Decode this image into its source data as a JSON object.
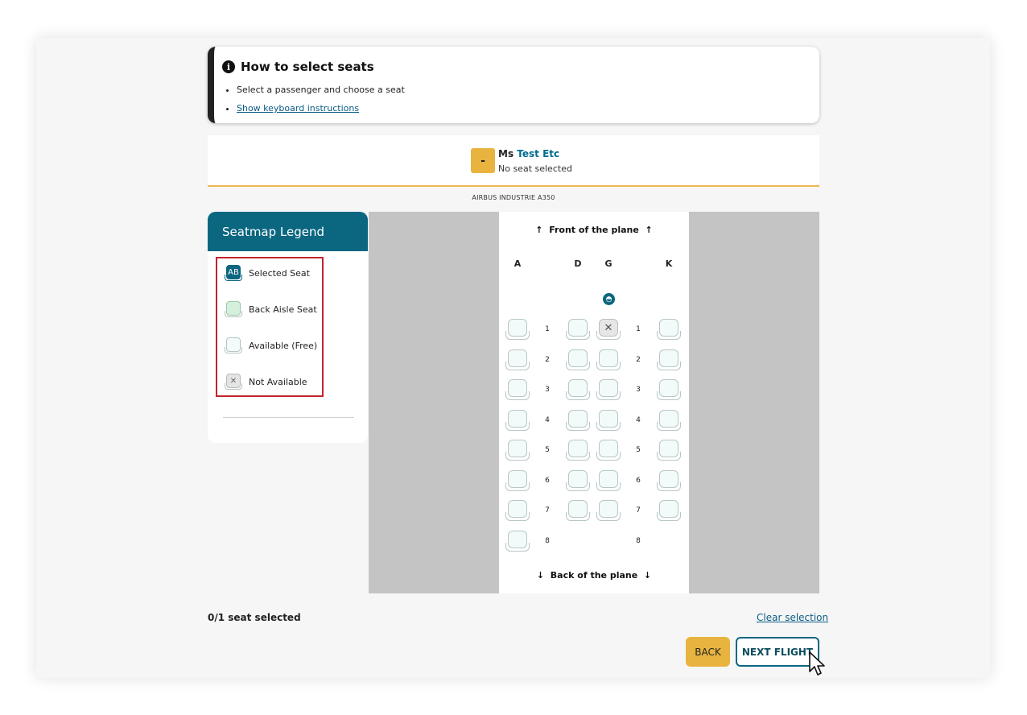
{
  "howto": {
    "title": "How to select seats",
    "item1": "Select a passenger and choose a seat",
    "item2": "Show keyboard instructions"
  },
  "passenger": {
    "button": "-",
    "title": "Ms",
    "name": "Test Etc",
    "seat_status": "No seat selected"
  },
  "aircraft": "AIRBUS INDUSTRIE A350",
  "legend": {
    "title": "Seatmap Legend",
    "items": [
      {
        "icon": "selected-seat-icon",
        "glyph": "AB",
        "label": "Selected Seat"
      },
      {
        "icon": "back-aisle-seat-icon",
        "glyph": "",
        "label": "Back Aisle Seat"
      },
      {
        "icon": "available-seat-icon",
        "glyph": "",
        "label": "Available (Free)"
      },
      {
        "icon": "not-available-seat-icon",
        "glyph": "✕",
        "label": "Not Available"
      }
    ]
  },
  "seatmap": {
    "front": "Front of the plane",
    "back": "Back of the plane",
    "columns": [
      "A",
      "D",
      "G",
      "K"
    ],
    "rows": [
      "1",
      "2",
      "3",
      "4",
      "5",
      "6",
      "7",
      "8"
    ],
    "not_available": [
      "1G"
    ],
    "missing": [
      "8D",
      "8G",
      "8K"
    ],
    "infant_icon": "bassinet-icon",
    "na_glyph": "✕"
  },
  "footer": {
    "count": "0/1 seat selected",
    "clear": "Clear selection",
    "back": "BACK",
    "next": "NEXT FLIGHT"
  },
  "colors": {
    "accent": "#0b6680",
    "yellow": "#e8b43f",
    "highlight_border": "#c0252b"
  }
}
